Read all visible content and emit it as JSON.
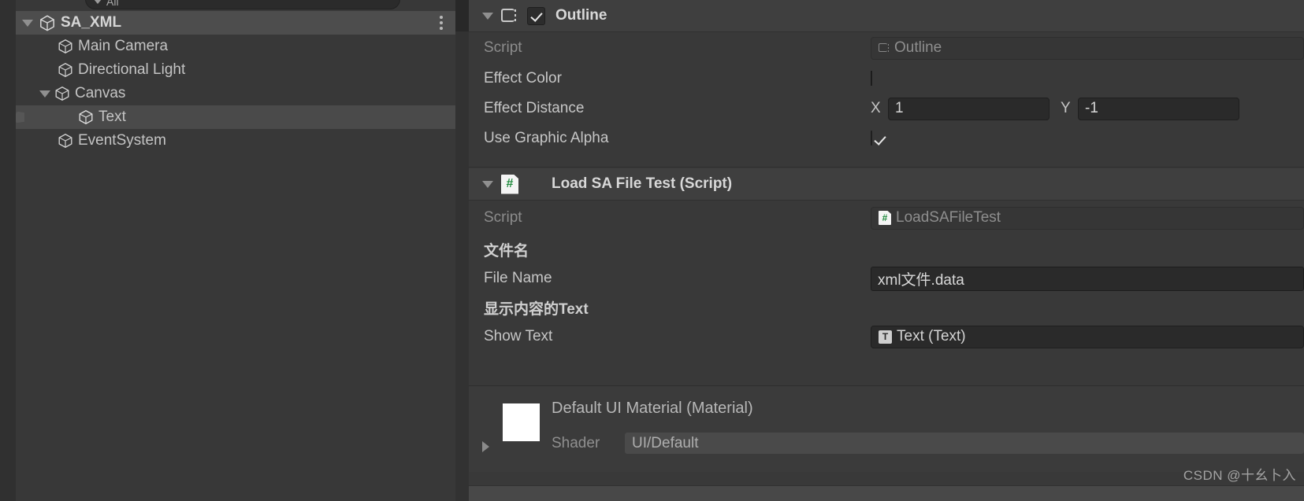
{
  "hierarchy": {
    "search": {
      "label": "All",
      "icon": "chevron-down-icon"
    },
    "kebab_icon": "kebab-menu-icon",
    "items": [
      {
        "label": "SA_XML",
        "icon": "unity-scene-icon",
        "depth": 0,
        "foldout": "expanded",
        "root": true,
        "selected": false
      },
      {
        "label": "Main Camera",
        "icon": "gameobject-icon",
        "depth": 1,
        "foldout": "none",
        "root": false,
        "selected": false
      },
      {
        "label": "Directional Light",
        "icon": "gameobject-icon",
        "depth": 1,
        "foldout": "none",
        "root": false,
        "selected": false
      },
      {
        "label": "Canvas",
        "icon": "gameobject-icon",
        "depth": 1,
        "foldout": "expanded",
        "root": false,
        "selected": false
      },
      {
        "label": "Text",
        "icon": "gameobject-icon",
        "depth": 2,
        "foldout": "none",
        "root": false,
        "selected": true
      },
      {
        "label": "EventSystem",
        "icon": "gameobject-icon",
        "depth": 1,
        "foldout": "none",
        "root": false,
        "selected": false
      }
    ]
  },
  "inspector": {
    "outline": {
      "title": "Outline",
      "enabled_checkbox": true,
      "icon": "outline-component-icon",
      "script": {
        "label": "Script",
        "value": "Outline",
        "icon": "outline-component-icon"
      },
      "effect_color": {
        "label": "Effect Color",
        "color": "#000000",
        "alpha_color": "#ffffff"
      },
      "effect_distance": {
        "label": "Effect Distance",
        "x_axis": "X",
        "x_value": "1",
        "y_axis": "Y",
        "y_value": "-1"
      },
      "use_graphic_alpha": {
        "label": "Use Graphic Alpha",
        "checked": true
      }
    },
    "load_sa_file_test": {
      "title": "Load SA File Test (Script)",
      "icon": "csharp-script-icon",
      "script": {
        "label": "Script",
        "value": "LoadSAFileTest",
        "icon": "csharp-script-icon"
      },
      "file_name": {
        "header": "文件名",
        "label": "File Name",
        "value": "xml文件.data"
      },
      "show_text": {
        "header": "显示内容的Text",
        "label": "Show Text",
        "value": "Text (Text)",
        "icon": "text-component-icon"
      }
    },
    "material": {
      "title": "Default UI Material (Material)",
      "swatch_color": "#ffffff",
      "foldout": "collapsed",
      "shader_label": "Shader",
      "shader_value": "UI/Default"
    }
  },
  "watermark": {
    "text": "CSDN @十幺卜入"
  }
}
